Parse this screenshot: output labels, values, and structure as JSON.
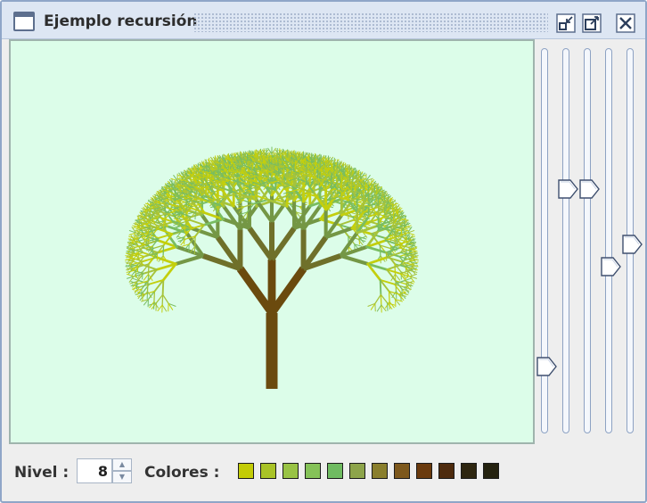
{
  "window": {
    "title": "Ejemplo recursión"
  },
  "tree": {
    "level": 8,
    "trunk_color": "#6b4a0e",
    "leaf_colors": [
      "#c3cf0d",
      "#a6c33a",
      "#78bd61"
    ]
  },
  "sliders": [
    {
      "name": "slider-1",
      "value": 0.16
    },
    {
      "name": "slider-2",
      "value": 0.64
    },
    {
      "name": "slider-3",
      "value": 0.64
    },
    {
      "name": "slider-4",
      "value": 0.43
    },
    {
      "name": "slider-5",
      "value": 0.49
    }
  ],
  "controls": {
    "nivel_label": "Nivel :",
    "nivel_value": "8",
    "colores_label": "Colores :"
  },
  "colors": [
    "#c3cc06",
    "#a9c327",
    "#99c345",
    "#85c258",
    "#6fbb61",
    "#8da44a",
    "#8a7f2d",
    "#7d581c",
    "#6a3a0d",
    "#4e2b0e",
    "#2e2610",
    "#24220f"
  ]
}
